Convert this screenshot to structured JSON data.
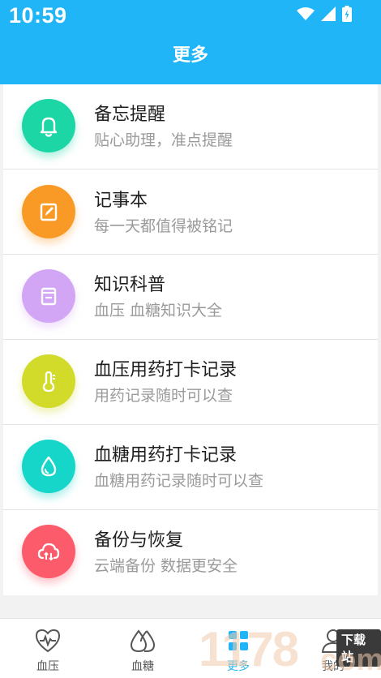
{
  "status_bar": {
    "time": "10:59"
  },
  "header": {
    "title": "更多"
  },
  "menu": [
    {
      "title": "备忘提醒",
      "subtitle": "贴心助理，准点提醒",
      "icon": "bell-icon",
      "color": "#1dd6a6"
    },
    {
      "title": "记事本",
      "subtitle": "每一天都值得被铭记",
      "icon": "edit-note-icon",
      "color": "#f99a27"
    },
    {
      "title": "知识科普",
      "subtitle": "血压 血糖知识大全",
      "icon": "book-icon",
      "color": "#d3a5f5"
    },
    {
      "title": "血压用药打卡记录",
      "subtitle": "用药记录随时可以查",
      "icon": "thermometer-icon",
      "color": "#d2da2a"
    },
    {
      "title": "血糖用药打卡记录",
      "subtitle": "血糖用药记录随时可以查",
      "icon": "drop-icon",
      "color": "#16d5c9"
    },
    {
      "title": "备份与恢复",
      "subtitle": "云端备份 数据更安全",
      "icon": "cloud-sync-icon",
      "color": "#fc5b6c"
    }
  ],
  "tabs": [
    {
      "label": "血压",
      "icon": "heart-pulse-icon"
    },
    {
      "label": "血糖",
      "icon": "drops-icon"
    },
    {
      "label": "更多",
      "icon": "grid-icon",
      "active": true
    },
    {
      "label": "我的",
      "icon": "person-icon"
    }
  ],
  "watermark": {
    "text": "1178",
    "badge": "下载站",
    "suffix": "com"
  }
}
